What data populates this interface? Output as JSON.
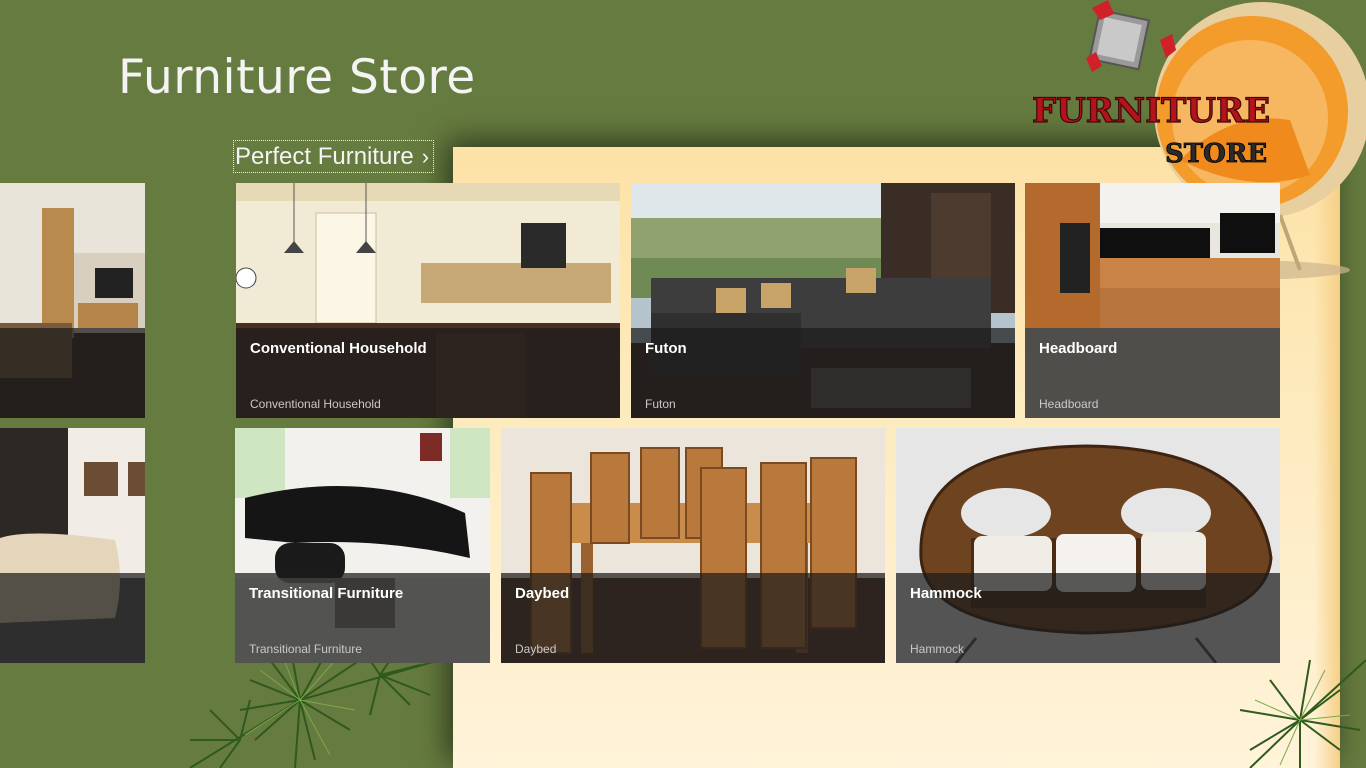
{
  "app": {
    "title": "Furniture Store"
  },
  "logo": {
    "line1": "FURNITURE",
    "line2": "STORE"
  },
  "group": {
    "label": "Perfect Furniture",
    "chevron": "›"
  },
  "tiles": [
    {
      "title": "Conventional Household",
      "subtitle": "Conventional Household"
    },
    {
      "title": "Futon",
      "subtitle": "Futon"
    },
    {
      "title": "Headboard",
      "subtitle": "Headboard"
    },
    {
      "title": "Transitional Furniture",
      "subtitle": "Transitional Furniture"
    },
    {
      "title": "Daybed",
      "subtitle": "Daybed"
    },
    {
      "title": "Hammock",
      "subtitle": "Hammock"
    }
  ],
  "colors": {
    "background": "#667b3f",
    "panel": "#fde2a6",
    "tile_overlay": "#1c1c1c",
    "logo_text": "#b5121b"
  }
}
